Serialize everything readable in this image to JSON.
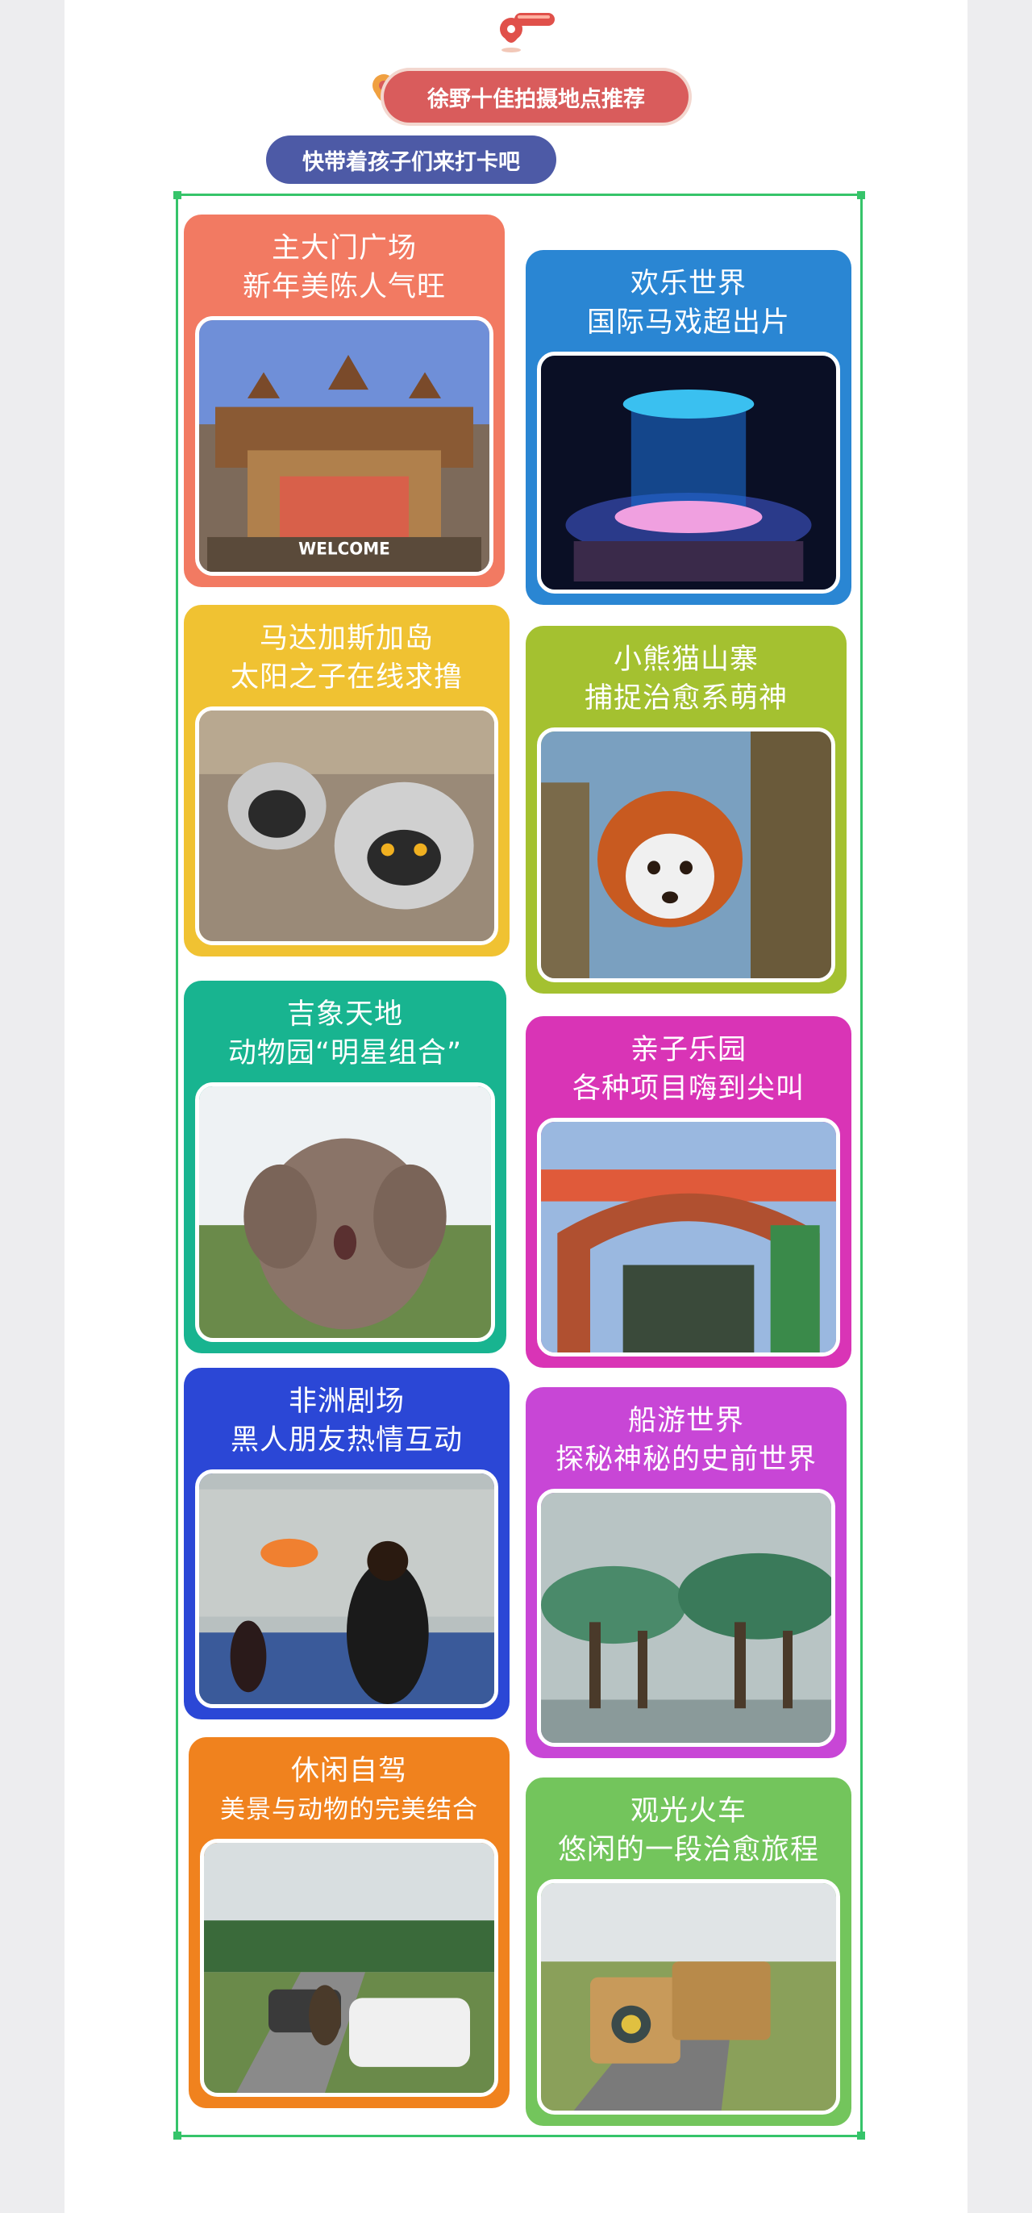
{
  "header": {
    "title": "徐野十佳拍摄地点推荐",
    "subtitle": "快带着孩子们来打卡吧"
  },
  "spots": [
    {
      "line1": "主大门广场",
      "line2": "新年美陈人气旺",
      "color": "#f27a62",
      "photo": "zoo-main-gate-photo",
      "sign": "WELCOME"
    },
    {
      "line1": "欢乐世界",
      "line2": "国际马戏超出片",
      "color": "#2a86d3",
      "photo": "circus-stage-photo"
    },
    {
      "line1": "马达加斯加岛",
      "line2": "太阳之子在线求撸",
      "color": "#f0c232",
      "photo": "lemurs-photo"
    },
    {
      "line1": "小熊猫山寨",
      "line2": "捕捉治愈系萌神",
      "color": "#a4c130",
      "photo": "red-panda-photo"
    },
    {
      "line1": "吉象天地",
      "line2": "动物园“明星组合”",
      "color": "#18b490",
      "photo": "elephant-photo"
    },
    {
      "line1": "亲子乐园",
      "line2": "各种项目嗨到尖叫",
      "color": "#d934b6",
      "photo": "playground-gate-photo"
    },
    {
      "line1": "非洲剧场",
      "line2": "黑人朋友热情互动",
      "color": "#2b47d6",
      "photo": "african-theater-photo"
    },
    {
      "line1": "船游世界",
      "line2": "探秘神秘的史前世界",
      "color": "#c846d6",
      "photo": "boat-world-photo"
    },
    {
      "line1": "休闲自驾",
      "line2": "美景与动物的完美结合",
      "color": "#f0821e",
      "photo": "self-drive-photo"
    },
    {
      "line1": "观光火车",
      "line2": "悠闲的一段治愈旅程",
      "color": "#73c55c",
      "photo": "sightseeing-train-photo"
    }
  ]
}
